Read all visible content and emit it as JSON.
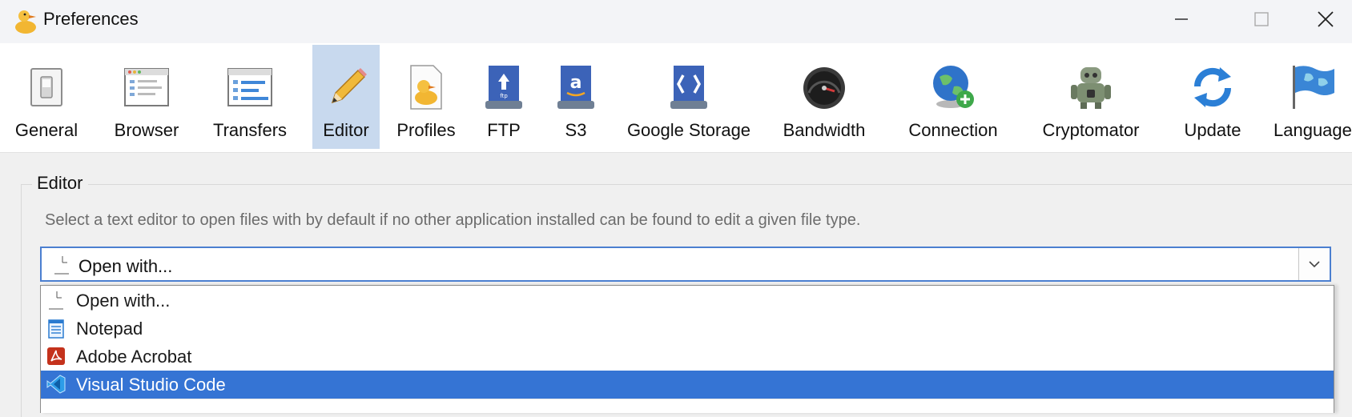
{
  "window": {
    "title": "Preferences"
  },
  "toolbar": {
    "items": [
      {
        "label": "General",
        "icon": "switch-icon"
      },
      {
        "label": "Browser",
        "icon": "browser-window-icon"
      },
      {
        "label": "Transfers",
        "icon": "transfers-window-icon"
      },
      {
        "label": "Editor",
        "icon": "pencil-icon",
        "selected": true
      },
      {
        "label": "Profiles",
        "icon": "duck-document-icon"
      },
      {
        "label": "FTP",
        "icon": "ftp-drive-icon"
      },
      {
        "label": "S3",
        "icon": "amazon-s3-drive-icon"
      },
      {
        "label": "Google Storage",
        "icon": "google-storage-drive-icon"
      },
      {
        "label": "Bandwidth",
        "icon": "bandwidth-gauge-icon"
      },
      {
        "label": "Connection",
        "icon": "globe-plus-icon"
      },
      {
        "label": "Cryptomator",
        "icon": "cryptomator-robot-icon"
      },
      {
        "label": "Update",
        "icon": "refresh-icon"
      },
      {
        "label": "Language",
        "icon": "flag-icon"
      }
    ]
  },
  "editor": {
    "group_title": "Editor",
    "description": "Select a text editor to open files with by default if no other application installed can be found to edit a given file type.",
    "selected_value": "Open with...",
    "options": [
      {
        "label": "Open with...",
        "icon": "blank-file-icon"
      },
      {
        "label": "Notepad",
        "icon": "notepad-icon"
      },
      {
        "label": "Adobe Acrobat",
        "icon": "adobe-acrobat-icon"
      },
      {
        "label": "Visual Studio Code",
        "icon": "vscode-icon",
        "highlighted": true
      }
    ]
  },
  "colors": {
    "accent": "#3574d4",
    "selected_tab": "#c8d9ee",
    "combo_border": "#4b7fd0"
  }
}
